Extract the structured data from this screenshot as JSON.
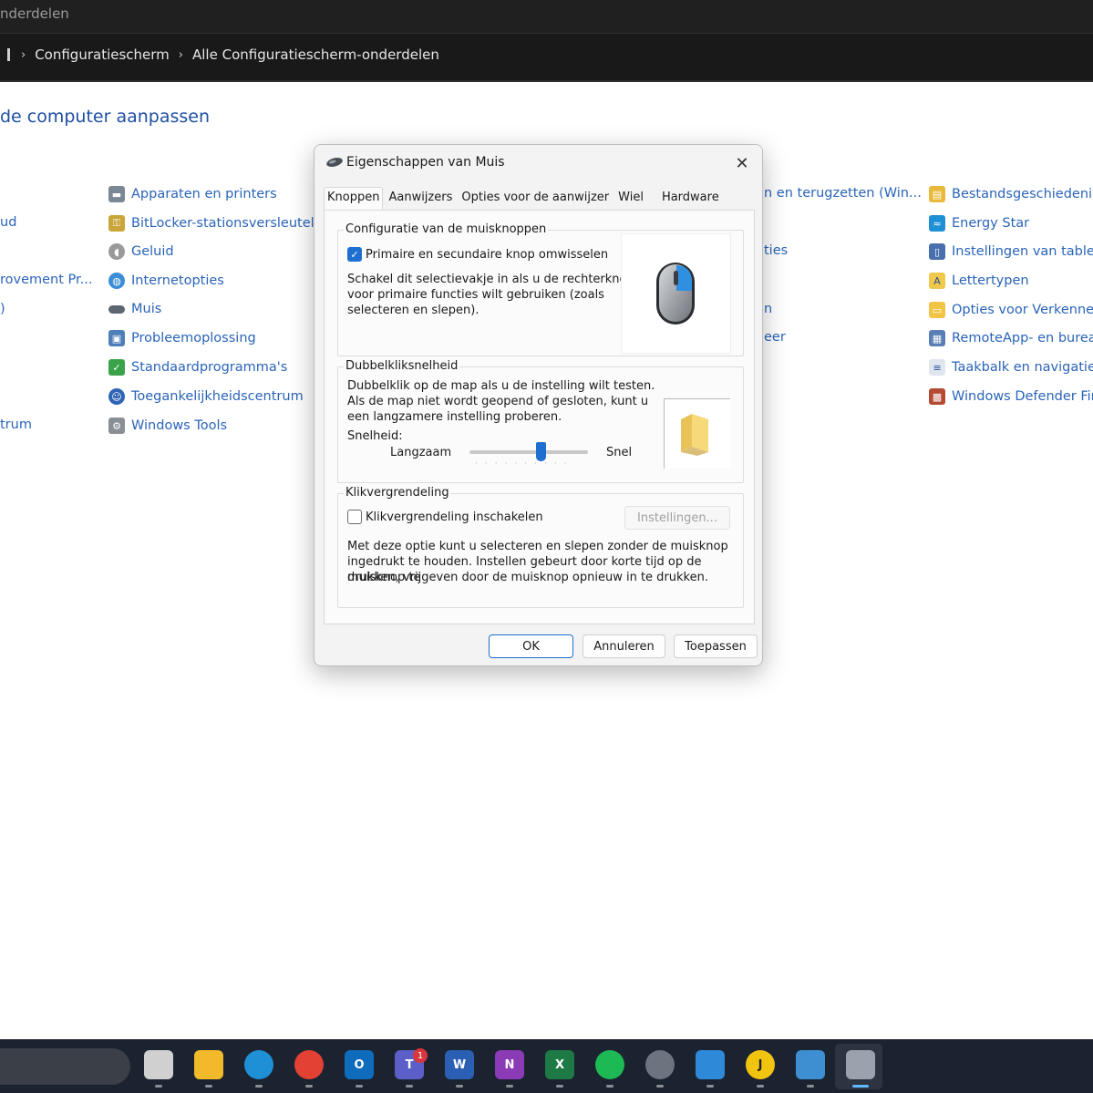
{
  "window": {
    "title": "nderdelen",
    "breadcrumb": [
      "Configuratiescherm",
      "Alle Configuratiescherm-onderdelen"
    ]
  },
  "content": {
    "heading": "de computer aanpassen",
    "col0": [
      "ud",
      "rovement Pr...",
      ")",
      "trum"
    ],
    "col1": [
      {
        "label": "Apparaten en printers",
        "icon": "printer-icon"
      },
      {
        "label": "BitLocker-stationsversleuteling",
        "icon": "key-icon"
      },
      {
        "label": "Geluid",
        "icon": "speaker-icon"
      },
      {
        "label": "Internetopties",
        "icon": "globe-icon"
      },
      {
        "label": "Muis",
        "icon": "mouse-icon"
      },
      {
        "label": "Probleemoplossing",
        "icon": "troubleshoot-icon"
      },
      {
        "label": "Standaardprogramma's",
        "icon": "default-programs-icon"
      },
      {
        "label": "Toegankelijkheidscentrum",
        "icon": "accessibility-icon"
      },
      {
        "label": "Windows Tools",
        "icon": "tools-icon"
      }
    ],
    "col2": [
      "n en terugzetten (Win...",
      "ties",
      "n",
      "eer"
    ],
    "col3": [
      {
        "label": "Bestandsgeschiedenis",
        "icon": "file-history-icon"
      },
      {
        "label": "Energy Star",
        "icon": "energy-star-icon"
      },
      {
        "label": "Instellingen van tablet-p",
        "icon": "tablet-icon"
      },
      {
        "label": "Lettertypen",
        "icon": "fonts-icon"
      },
      {
        "label": "Opties voor Verkenner",
        "icon": "folder-options-icon"
      },
      {
        "label": "RemoteApp- en bureau",
        "icon": "remoteapp-icon"
      },
      {
        "label": "Taakbalk en navigatie",
        "icon": "taskbar-icon"
      },
      {
        "label": "Windows Defender Fire",
        "icon": "firewall-icon"
      }
    ]
  },
  "dialog": {
    "title": "Eigenschappen van Muis",
    "tabs": [
      "Knoppen",
      "Aanwijzers",
      "Opties voor de aanwijzer",
      "Wiel",
      "Hardware"
    ],
    "group1": {
      "label": "Configuratie van de muisknoppen",
      "checkbox": "Primaire en secundaire knop omwisselen",
      "checked": true,
      "desc1": "Schakel dit selectievakje in als u de rechterknop",
      "desc2": "voor primaire functies wilt gebruiken (zoals",
      "desc3": "selecteren en slepen)."
    },
    "group2": {
      "label": "Dubbelkliksnelheid",
      "desc1": "Dubbelklik op de map als u de instelling wilt testen.",
      "desc2": "Als de map niet wordt geopend of gesloten, kunt u",
      "desc3": "een langzamere instelling proberen.",
      "speed_label": "Snelheid:",
      "slow": "Langzaam",
      "fast": "Snel",
      "speed_value": 0.6
    },
    "group3": {
      "label": "Klikvergrendeling",
      "checkbox": "Klikvergrendeling inschakelen",
      "checked": false,
      "settings_button": "Instellingen...",
      "desc1": "Met deze optie kunt u selecteren en slepen zonder de muisknop",
      "desc2": "ingedrukt te houden. Instellen gebeurt door korte tijd op de muisknop te",
      "desc3": "drukken, vrijgeven door de muisknop opnieuw in te drukken."
    },
    "buttons": {
      "ok": "OK",
      "cancel": "Annuleren",
      "apply": "Toepassen"
    }
  },
  "taskbar": {
    "apps": [
      {
        "name": "task-view",
        "glyph": "",
        "color": "#d0d0d0"
      },
      {
        "name": "file-explorer",
        "glyph": "",
        "color": "#f2b92b"
      },
      {
        "name": "edge",
        "glyph": "",
        "color": "#1f8fd6"
      },
      {
        "name": "chrome",
        "glyph": "",
        "color": "#e34133"
      },
      {
        "name": "outlook",
        "glyph": "O",
        "color": "#0f6cbd"
      },
      {
        "name": "teams",
        "glyph": "T",
        "color": "#5b5fc7"
      },
      {
        "name": "word",
        "glyph": "W",
        "color": "#2b5fb4"
      },
      {
        "name": "onenote",
        "glyph": "N",
        "color": "#8a3bb5"
      },
      {
        "name": "excel",
        "glyph": "X",
        "color": "#1e7a45"
      },
      {
        "name": "spotify",
        "glyph": "",
        "color": "#1db954"
      },
      {
        "name": "settings",
        "glyph": "",
        "color": "#6c7480"
      },
      {
        "name": "photos",
        "glyph": "",
        "color": "#2e89d8"
      },
      {
        "name": "j-app",
        "glyph": "J",
        "color": "#f1c40f"
      },
      {
        "name": "control-panel",
        "glyph": "",
        "color": "#3d8fd1"
      },
      {
        "name": "mouse-properties",
        "glyph": "",
        "color": "#9aa3ad"
      }
    ],
    "teams_badge": "1"
  }
}
